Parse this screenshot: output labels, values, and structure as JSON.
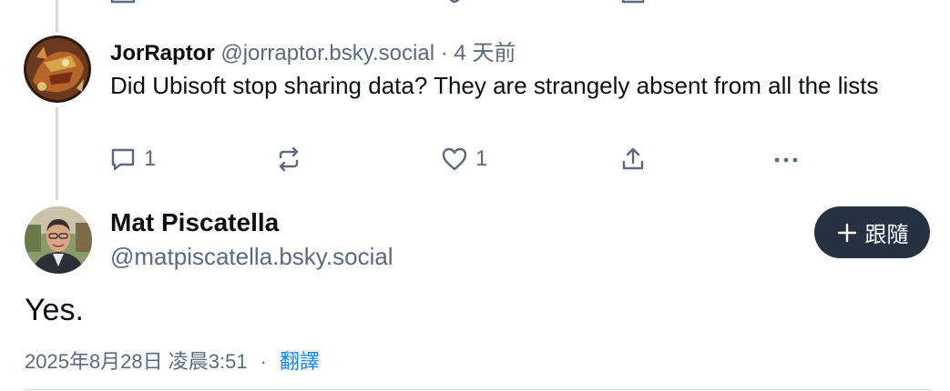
{
  "reply": {
    "author_name": "JorRaptor",
    "author_handle": "@jorraptor.bsky.social",
    "separator": " · ",
    "time_ago": "4 天前",
    "text": "Did Ubisoft stop sharing data? They are strangely absent from all the lists",
    "reply_count": "1",
    "like_count": "1"
  },
  "post": {
    "author_name": "Mat Piscatella",
    "author_handle": "@matpiscatella.bsky.social",
    "follow_label": "跟隨",
    "text": "Yes.",
    "timestamp": "2025年8月28日 凌晨3:51",
    "meta_dot": "·",
    "translate_label": "翻譯"
  },
  "icons": {
    "reply": "reply-bubble-icon",
    "repost": "repost-icon",
    "like": "heart-icon",
    "share": "share-icon",
    "more": "more-dots-icon",
    "plus": "plus-icon"
  },
  "colors": {
    "text_primary": "#0b0f14",
    "text_secondary": "#5b6b7c",
    "follow_bg": "#263241",
    "link": "#1083fe",
    "thread_line": "#d4dbe2"
  }
}
